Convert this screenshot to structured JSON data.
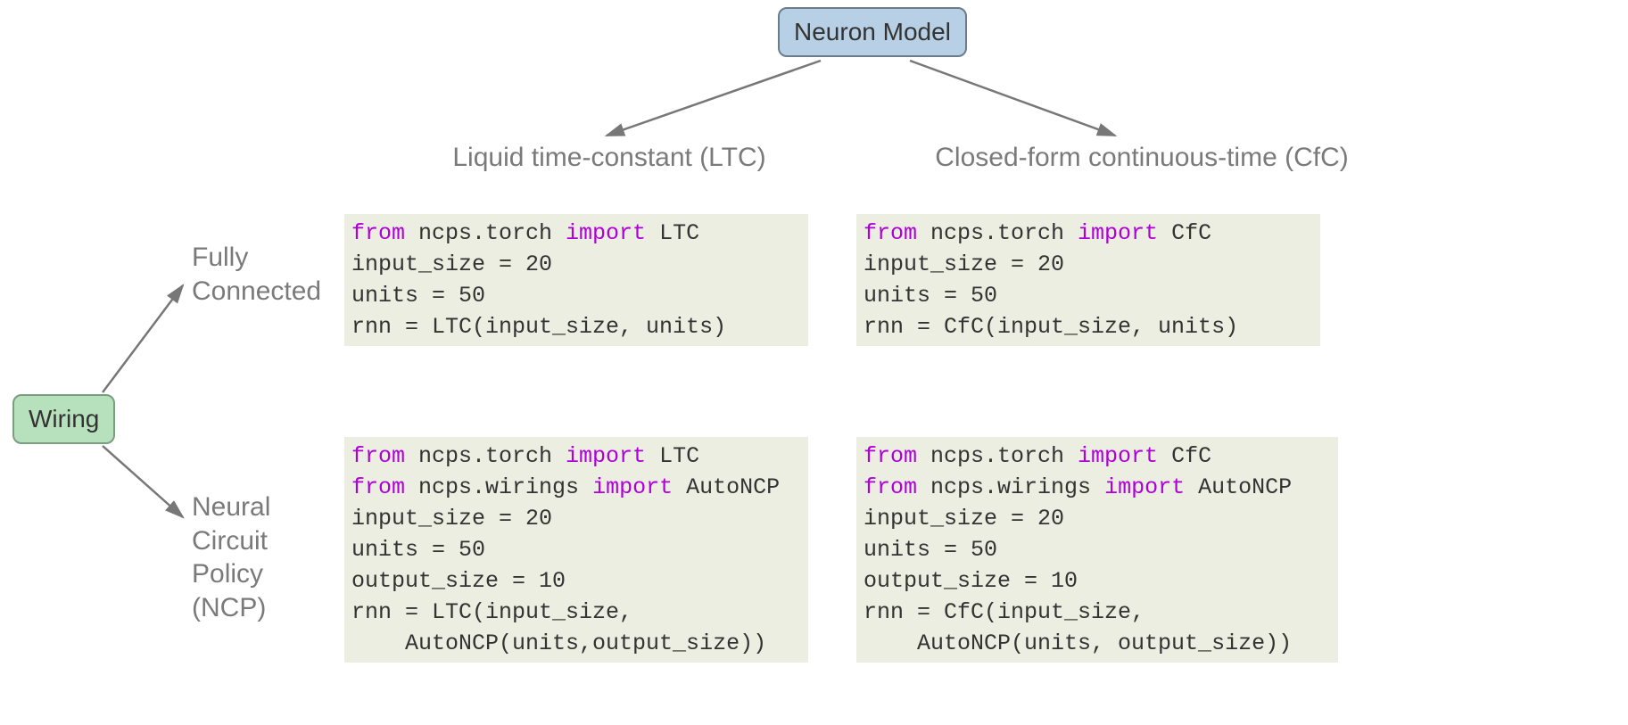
{
  "nodes": {
    "neuron_model": "Neuron Model",
    "wiring": "Wiring"
  },
  "columns": {
    "ltc": "Liquid time-constant (LTC)",
    "cfc": "Closed-form continuous-time (CfC)"
  },
  "rows": {
    "fully_connected": "Fully\nConnected",
    "ncp": "Neural\nCircuit\nPolicy\n(NCP)"
  },
  "code": {
    "fc_ltc": {
      "l1_from": "from",
      "l1_mod": " ncps.torch ",
      "l1_import": "import",
      "l1_sym": " LTC",
      "l2": "input_size = 20",
      "l3": "units = 50",
      "l4": "rnn = LTC(input_size, units)"
    },
    "fc_cfc": {
      "l1_from": "from",
      "l1_mod": " ncps.torch ",
      "l1_import": "import",
      "l1_sym": " CfC",
      "l2": "input_size = 20",
      "l3": "units = 50",
      "l4": "rnn = CfC(input_size, units)"
    },
    "ncp_ltc": {
      "l1_from": "from",
      "l1_mod": " ncps.torch ",
      "l1_import": "import",
      "l1_sym": " LTC",
      "l2_from": "from",
      "l2_mod": " ncps.wirings ",
      "l2_import": "import",
      "l2_sym": " AutoNCP",
      "l3": "input_size = 20",
      "l4": "units = 50",
      "l5": "output_size = 10",
      "l6": "rnn = LTC(input_size,",
      "l7": "    AutoNCP(units,output_size))"
    },
    "ncp_cfc": {
      "l1_from": "from",
      "l1_mod": " ncps.torch ",
      "l1_import": "import",
      "l1_sym": " CfC",
      "l2_from": "from",
      "l2_mod": " ncps.wirings ",
      "l2_import": "import",
      "l2_sym": " AutoNCP",
      "l3": "input_size = 20",
      "l4": "units = 50",
      "l5": "output_size = 10",
      "l6": "rnn = CfC(input_size,",
      "l7": "    AutoNCP(units, output_size))"
    }
  }
}
